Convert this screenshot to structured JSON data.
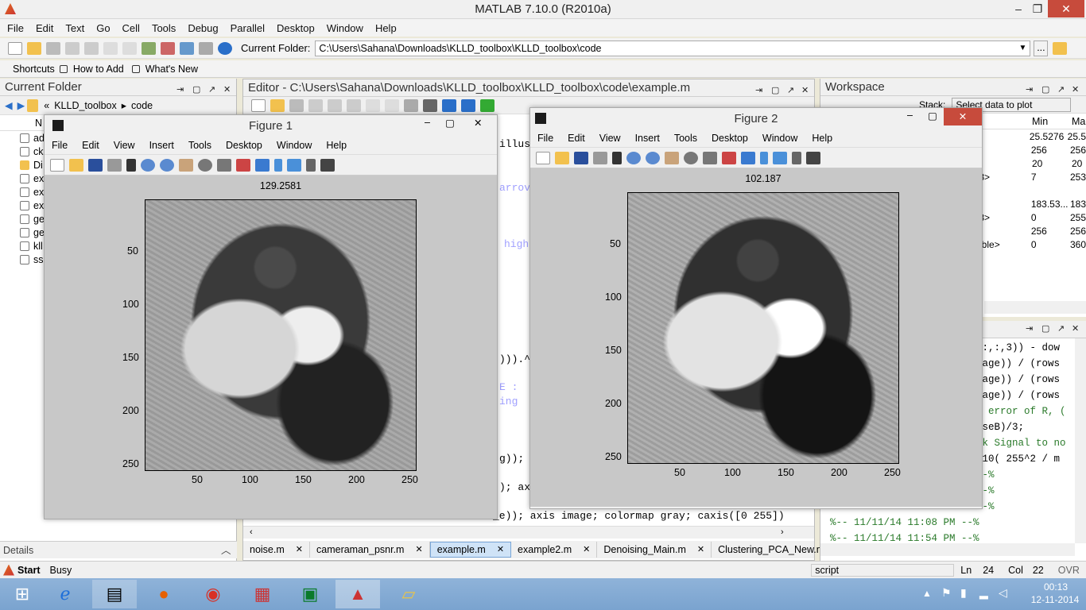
{
  "window": {
    "title": "MATLAB  7.10.0 (R2010a)",
    "min": "–",
    "max": "❐",
    "close": "✕"
  },
  "menu": [
    "File",
    "Edit",
    "Text",
    "Go",
    "Cell",
    "Tools",
    "Debug",
    "Parallel",
    "Desktop",
    "Window",
    "Help"
  ],
  "toolbar": {
    "current_folder_label": "Current Folder:",
    "current_folder_value": "C:\\Users\\Sahana\\Downloads\\KLLD_toolbox\\KLLD_toolbox\\code",
    "browse": "..."
  },
  "shortcuts": {
    "label": "Shortcuts",
    "how_to_add": "How to Add",
    "whats_new": "What's New"
  },
  "current_folder": {
    "title": "Current Folder",
    "crumbs": [
      "«",
      "KLLD_toolbox",
      "▸",
      "code"
    ],
    "col_header": "N",
    "files": [
      "ad",
      "ck",
      "Di",
      "ex",
      "ex",
      "ex",
      "ge",
      "ge",
      "kll",
      "ssi"
    ],
    "details": "Details"
  },
  "editor": {
    "title": "Editor - C:\\Users\\Sahana\\Downloads\\KLLD_toolbox\\KLLD_toolbox\\code\\example.m",
    "code_lines": [
      {
        "t": "illus"
      },
      {
        "t": "arrov",
        "c": "kw"
      },
      {
        "t": "high",
        "c": "kw"
      },
      {
        "t": "))).^2"
      },
      {
        "t": "E :",
        "c": "kw"
      },
      {
        "t": "ing",
        "c": "kw"
      },
      {
        "t": "g));"
      },
      {
        "t": "); ax"
      },
      {
        "t": "_e)); axis image; colormap gray; caxis([0 255])"
      }
    ],
    "tabs": [
      {
        "label": "noise.m",
        "active": false
      },
      {
        "label": "cameraman_psnr.m",
        "active": false
      },
      {
        "label": "example.m",
        "active": true
      },
      {
        "label": "example2.m",
        "active": false
      },
      {
        "label": "Denoising_Main.m",
        "active": false
      },
      {
        "label": "Clustering_PCA_New.m",
        "active": false
      }
    ]
  },
  "workspace": {
    "title": "Workspace",
    "stack_label": "Stack:",
    "select_plot": "Select data to plot",
    "cols": [
      "Min",
      "Ma"
    ],
    "rows": [
      {
        "name": "",
        "min": "25.5276",
        "max": "25.5"
      },
      {
        "name": "",
        "min": "256",
        "max": "256"
      },
      {
        "name": "",
        "min": "20",
        "max": "20"
      },
      {
        "name": "t8>",
        "min": "7",
        "max": "253"
      },
      {
        "name": "",
        "min": "183.53...",
        "max": "183"
      },
      {
        "name": "t8>",
        "min": "0",
        "max": "255"
      },
      {
        "name": "",
        "min": "256",
        "max": "256"
      },
      {
        "name": "able>",
        "min": "0",
        "max": "360"
      }
    ]
  },
  "command_history": {
    "lines": [
      {
        "t": "(:,:,3)) - dow",
        "c": ""
      },
      {
        "t": "hage)) / (rows",
        "c": ""
      },
      {
        "t": "hage)) / (rows",
        "c": ""
      },
      {
        "t": "hage)) / (rows",
        "c": ""
      },
      {
        "t": "e error of R, (",
        "c": "cm"
      },
      {
        "t": "nseB)/3;",
        "c": ""
      },
      {
        "t": "ak Signal to no",
        "c": "cm"
      },
      {
        "t": "g10( 255^2 / m",
        "c": ""
      },
      {
        "t": "--%",
        "c": "cm"
      },
      {
        "t": "--%",
        "c": "cm"
      },
      {
        "t": "--%",
        "c": "cm"
      },
      {
        "t": "%-- 11/11/14 11:08 PM --%",
        "c": "cm"
      },
      {
        "t": "%-- 11/11/14 11:54 PM --%",
        "c": "cm"
      }
    ]
  },
  "figure1": {
    "title": "Figure 1",
    "menu": [
      "File",
      "Edit",
      "View",
      "Insert",
      "Tools",
      "Desktop",
      "Window",
      "Help"
    ],
    "plot_title": "129.2581",
    "yticks": [
      "50",
      "100",
      "150",
      "200",
      "250"
    ],
    "xticks": [
      "50",
      "100",
      "150",
      "200",
      "250"
    ]
  },
  "figure2": {
    "title": "Figure 2",
    "menu": [
      "File",
      "Edit",
      "View",
      "Insert",
      "Tools",
      "Desktop",
      "Window",
      "Help"
    ],
    "plot_title": "102.187",
    "yticks": [
      "50",
      "100",
      "150",
      "200",
      "250"
    ],
    "xticks": [
      "50",
      "100",
      "150",
      "200",
      "250"
    ]
  },
  "status": {
    "start": "Start",
    "busy": "Busy",
    "script": "script",
    "ln_label": "Ln",
    "ln": "24",
    "col_label": "Col",
    "col": "22",
    "ovr": "OVR"
  },
  "taskbar": {
    "time": "00:13",
    "date": "12-11-2014"
  }
}
